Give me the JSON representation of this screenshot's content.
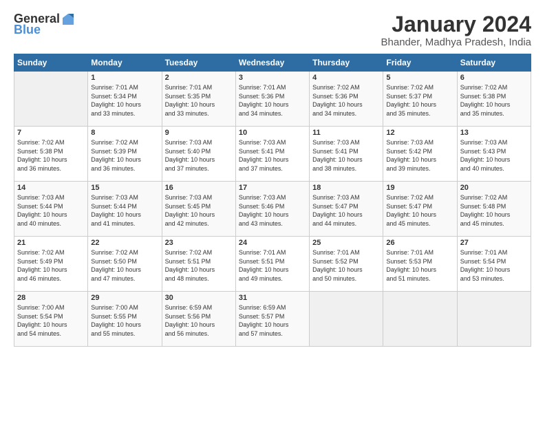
{
  "logo": {
    "line1": "General",
    "line2": "Blue"
  },
  "title": "January 2024",
  "subtitle": "Bhander, Madhya Pradesh, India",
  "days_header": [
    "Sunday",
    "Monday",
    "Tuesday",
    "Wednesday",
    "Thursday",
    "Friday",
    "Saturday"
  ],
  "weeks": [
    [
      {
        "num": "",
        "info": ""
      },
      {
        "num": "1",
        "info": "Sunrise: 7:01 AM\nSunset: 5:34 PM\nDaylight: 10 hours\nand 33 minutes."
      },
      {
        "num": "2",
        "info": "Sunrise: 7:01 AM\nSunset: 5:35 PM\nDaylight: 10 hours\nand 33 minutes."
      },
      {
        "num": "3",
        "info": "Sunrise: 7:01 AM\nSunset: 5:36 PM\nDaylight: 10 hours\nand 34 minutes."
      },
      {
        "num": "4",
        "info": "Sunrise: 7:02 AM\nSunset: 5:36 PM\nDaylight: 10 hours\nand 34 minutes."
      },
      {
        "num": "5",
        "info": "Sunrise: 7:02 AM\nSunset: 5:37 PM\nDaylight: 10 hours\nand 35 minutes."
      },
      {
        "num": "6",
        "info": "Sunrise: 7:02 AM\nSunset: 5:38 PM\nDaylight: 10 hours\nand 35 minutes."
      }
    ],
    [
      {
        "num": "7",
        "info": "Sunrise: 7:02 AM\nSunset: 5:38 PM\nDaylight: 10 hours\nand 36 minutes."
      },
      {
        "num": "8",
        "info": "Sunrise: 7:02 AM\nSunset: 5:39 PM\nDaylight: 10 hours\nand 36 minutes."
      },
      {
        "num": "9",
        "info": "Sunrise: 7:03 AM\nSunset: 5:40 PM\nDaylight: 10 hours\nand 37 minutes."
      },
      {
        "num": "10",
        "info": "Sunrise: 7:03 AM\nSunset: 5:41 PM\nDaylight: 10 hours\nand 37 minutes."
      },
      {
        "num": "11",
        "info": "Sunrise: 7:03 AM\nSunset: 5:41 PM\nDaylight: 10 hours\nand 38 minutes."
      },
      {
        "num": "12",
        "info": "Sunrise: 7:03 AM\nSunset: 5:42 PM\nDaylight: 10 hours\nand 39 minutes."
      },
      {
        "num": "13",
        "info": "Sunrise: 7:03 AM\nSunset: 5:43 PM\nDaylight: 10 hours\nand 40 minutes."
      }
    ],
    [
      {
        "num": "14",
        "info": "Sunrise: 7:03 AM\nSunset: 5:44 PM\nDaylight: 10 hours\nand 40 minutes."
      },
      {
        "num": "15",
        "info": "Sunrise: 7:03 AM\nSunset: 5:44 PM\nDaylight: 10 hours\nand 41 minutes."
      },
      {
        "num": "16",
        "info": "Sunrise: 7:03 AM\nSunset: 5:45 PM\nDaylight: 10 hours\nand 42 minutes."
      },
      {
        "num": "17",
        "info": "Sunrise: 7:03 AM\nSunset: 5:46 PM\nDaylight: 10 hours\nand 43 minutes."
      },
      {
        "num": "18",
        "info": "Sunrise: 7:03 AM\nSunset: 5:47 PM\nDaylight: 10 hours\nand 44 minutes."
      },
      {
        "num": "19",
        "info": "Sunrise: 7:02 AM\nSunset: 5:47 PM\nDaylight: 10 hours\nand 45 minutes."
      },
      {
        "num": "20",
        "info": "Sunrise: 7:02 AM\nSunset: 5:48 PM\nDaylight: 10 hours\nand 45 minutes."
      }
    ],
    [
      {
        "num": "21",
        "info": "Sunrise: 7:02 AM\nSunset: 5:49 PM\nDaylight: 10 hours\nand 46 minutes."
      },
      {
        "num": "22",
        "info": "Sunrise: 7:02 AM\nSunset: 5:50 PM\nDaylight: 10 hours\nand 47 minutes."
      },
      {
        "num": "23",
        "info": "Sunrise: 7:02 AM\nSunset: 5:51 PM\nDaylight: 10 hours\nand 48 minutes."
      },
      {
        "num": "24",
        "info": "Sunrise: 7:01 AM\nSunset: 5:51 PM\nDaylight: 10 hours\nand 49 minutes."
      },
      {
        "num": "25",
        "info": "Sunrise: 7:01 AM\nSunset: 5:52 PM\nDaylight: 10 hours\nand 50 minutes."
      },
      {
        "num": "26",
        "info": "Sunrise: 7:01 AM\nSunset: 5:53 PM\nDaylight: 10 hours\nand 51 minutes."
      },
      {
        "num": "27",
        "info": "Sunrise: 7:01 AM\nSunset: 5:54 PM\nDaylight: 10 hours\nand 53 minutes."
      }
    ],
    [
      {
        "num": "28",
        "info": "Sunrise: 7:00 AM\nSunset: 5:54 PM\nDaylight: 10 hours\nand 54 minutes."
      },
      {
        "num": "29",
        "info": "Sunrise: 7:00 AM\nSunset: 5:55 PM\nDaylight: 10 hours\nand 55 minutes."
      },
      {
        "num": "30",
        "info": "Sunrise: 6:59 AM\nSunset: 5:56 PM\nDaylight: 10 hours\nand 56 minutes."
      },
      {
        "num": "31",
        "info": "Sunrise: 6:59 AM\nSunset: 5:57 PM\nDaylight: 10 hours\nand 57 minutes."
      },
      {
        "num": "",
        "info": ""
      },
      {
        "num": "",
        "info": ""
      },
      {
        "num": "",
        "info": ""
      }
    ]
  ]
}
